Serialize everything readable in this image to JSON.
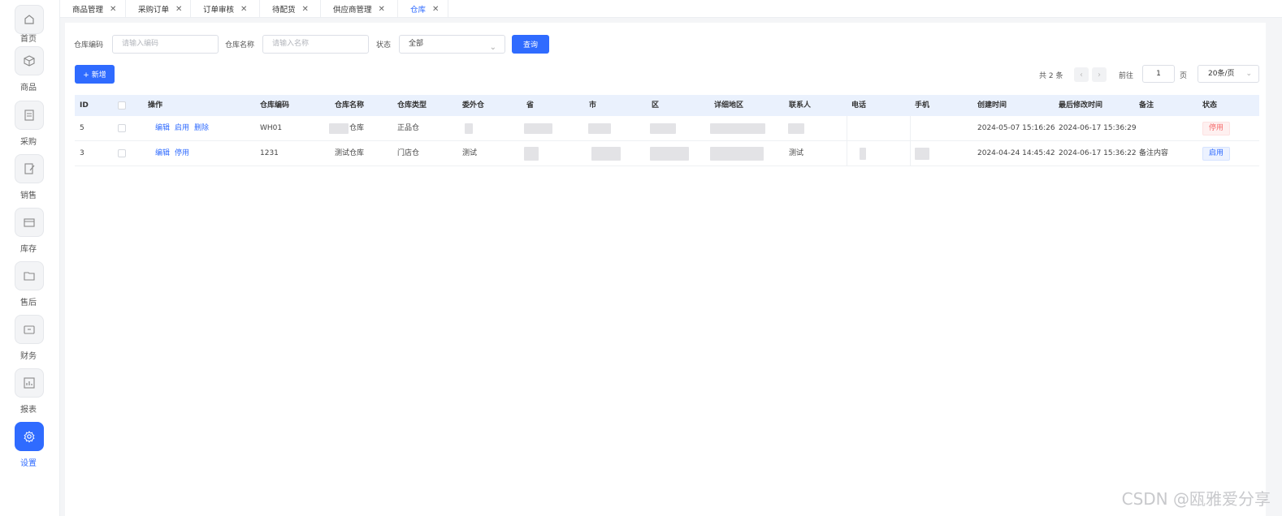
{
  "sidebar": {
    "items": [
      {
        "label": "首页",
        "icon": "home-icon"
      },
      {
        "label": "商品",
        "icon": "cube-icon"
      },
      {
        "label": "采购",
        "icon": "purchase-icon"
      },
      {
        "label": "销售",
        "icon": "sales-icon"
      },
      {
        "label": "库存",
        "icon": "inventory-icon"
      },
      {
        "label": "售后",
        "icon": "after-sales-icon"
      },
      {
        "label": "财务",
        "icon": "finance-icon"
      },
      {
        "label": "报表",
        "icon": "report-icon"
      },
      {
        "label": "设置",
        "icon": "settings-icon"
      }
    ],
    "active": "设置"
  },
  "tabs": [
    {
      "label": "商品管理"
    },
    {
      "label": "采购订单"
    },
    {
      "label": "订单审核"
    },
    {
      "label": "待配货"
    },
    {
      "label": "供应商管理"
    },
    {
      "label": "仓库"
    }
  ],
  "filters": {
    "code_label": "仓库编码",
    "code_placeholder": "请输入编码",
    "name_label": "仓库名称",
    "name_placeholder": "请输入名称",
    "status_label": "状态",
    "status_value": "全部",
    "search_button": "查询"
  },
  "toolbar": {
    "add_button": "+ 新增"
  },
  "pagination": {
    "total": "共 2 条",
    "goto_label": "前往",
    "page": "1",
    "page_unit": "页",
    "page_size": "20条/页"
  },
  "table": {
    "headers": [
      "ID",
      "操作",
      "仓库编码",
      "仓库名称",
      "仓库类型",
      "委外仓",
      "省",
      "市",
      "区",
      "详细地区",
      "联系人",
      "电话",
      "手机",
      "创建时间",
      "最后修改时间",
      "备注",
      "状态"
    ],
    "rows": [
      {
        "id": "5",
        "actions": [
          "编辑",
          "启用",
          "删除"
        ],
        "code": "WH01",
        "name": "仓库",
        "type": "正品仓",
        "outsourced": "",
        "contact": "",
        "created": "2024-05-07 15:16:26",
        "modified": "2024-06-17 15:36:29",
        "remark": "",
        "status": "停用"
      },
      {
        "id": "3",
        "actions": [
          "编辑",
          "停用"
        ],
        "code": "1231",
        "name": "测试仓库",
        "type": "门店仓",
        "outsourced": "测试",
        "contact": "测试",
        "created": "2024-04-24 14:45:42",
        "modified": "2024-06-17 15:36:22",
        "remark": "备注内容",
        "status": "启用"
      }
    ]
  },
  "watermark": "CSDN @瓯雅爱分享",
  "colors": {
    "accent": "#2f6bff",
    "header_bg": "#eaf1fd",
    "danger": "#f56c6c"
  }
}
